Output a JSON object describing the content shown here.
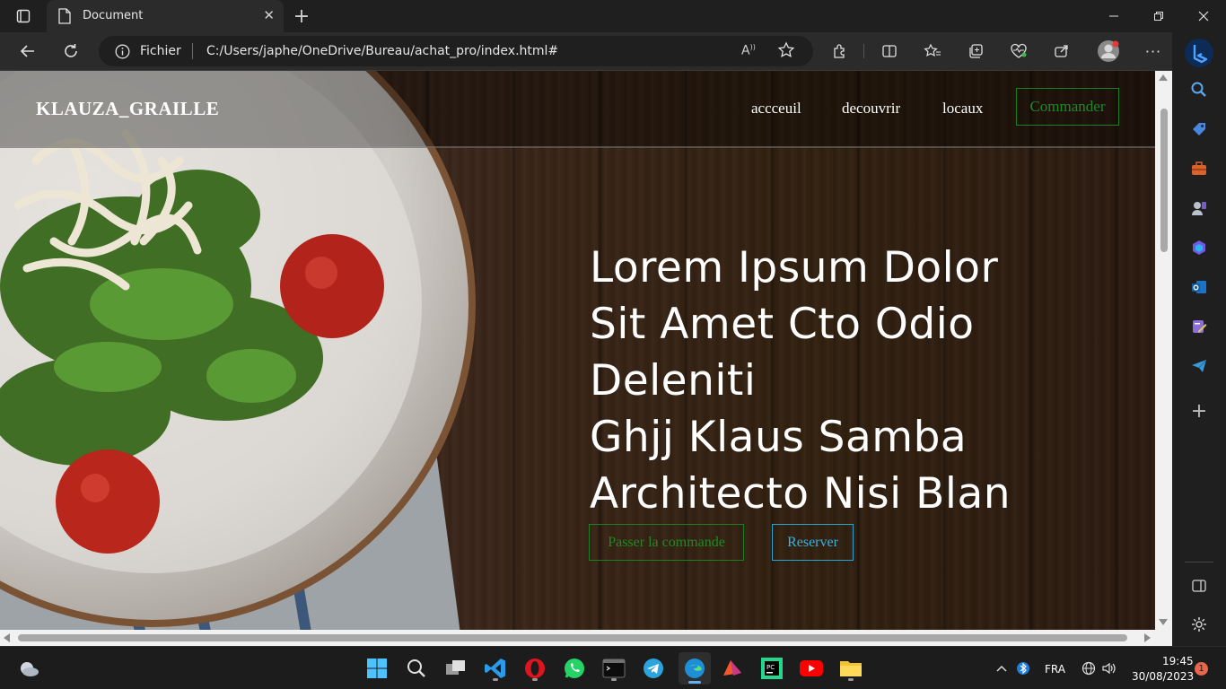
{
  "browser": {
    "tab_title": "Document",
    "address_label": "Fichier",
    "url": "C:/Users/japhe/OneDrive/Bureau/achat_pro/index.html#",
    "read_aloud_icon": "A̅",
    "accent_blue": "#1f7bd8"
  },
  "site": {
    "logo": "KLAUZA_GRAILLE",
    "nav": [
      "accceuil",
      "decouvrir",
      "locaux"
    ],
    "nav_cta": "Commander",
    "hero_lines": [
      "Lorem Ipsum Dolor",
      "Sit Amet Cto Odio",
      "Deleniti",
      "Ghjj Klaus Samba",
      "Architecto Nisi Blan"
    ],
    "btn_order": "Passer la commande",
    "btn_reserve": "Reserver",
    "colors": {
      "order_green": "#1f8a24",
      "reserve_blue": "#35b4e6"
    }
  },
  "taskbar": {
    "language": "FRA",
    "time": "19:45",
    "date": "30/08/2023",
    "notification_count": "1"
  }
}
